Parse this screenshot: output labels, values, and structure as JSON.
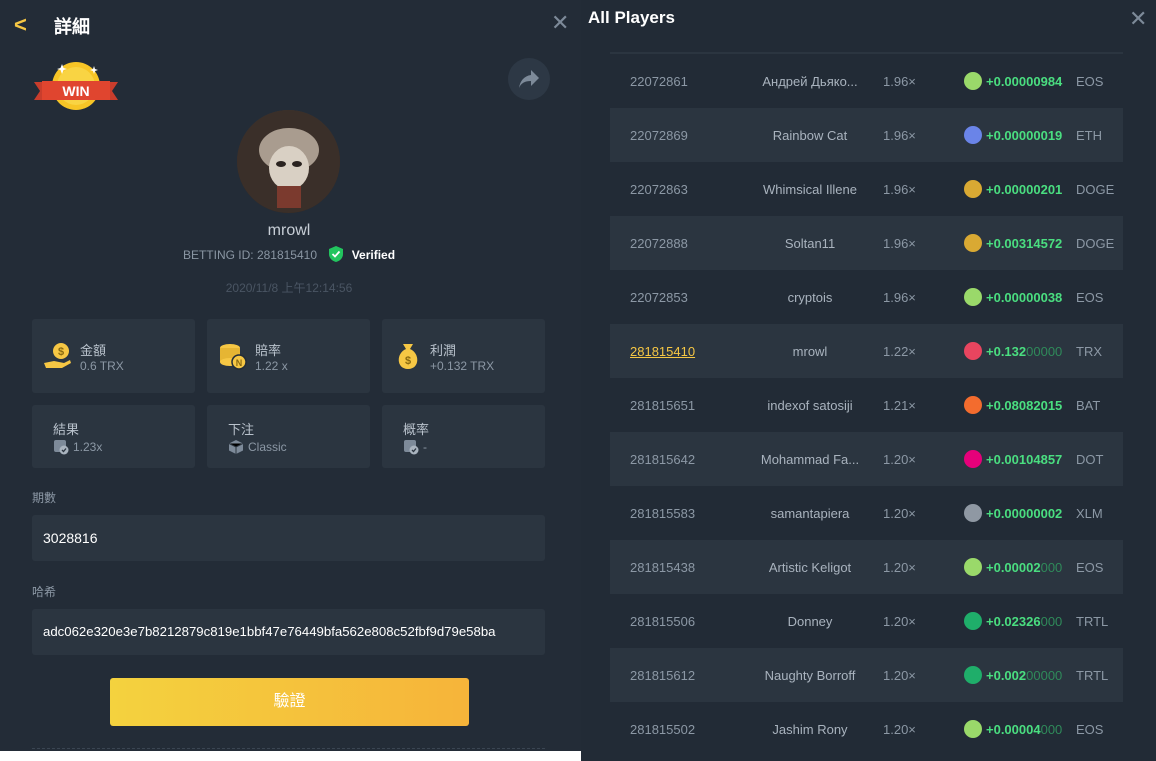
{
  "detail": {
    "back_glyph": "<",
    "title": "詳細",
    "close_glyph": "✕",
    "win_badge": "WIN",
    "username": "mrowl",
    "betting_id": "BETTING ID: 281815410",
    "verified": "Verified",
    "datetime": "2020/11/8 上午12:14:56",
    "stats": [
      {
        "label": "金額",
        "value": "0.6 TRX",
        "icon": "money-hand-icon"
      },
      {
        "label": "賠率",
        "value": "1.22 x",
        "icon": "coin-stack-icon"
      },
      {
        "label": "利潤",
        "value": "+0.132 TRX",
        "icon": "money-bag-icon"
      }
    ],
    "stats2": [
      {
        "label": "結果",
        "value": "1.23x",
        "icon": "dice-check-icon"
      },
      {
        "label": "下注",
        "value": "Classic",
        "icon": "dice-icon"
      },
      {
        "label": "概率",
        "value": "-",
        "icon": "dice-check-icon"
      }
    ],
    "round_label": "期數",
    "round_value": "3028816",
    "hash_label": "哈希",
    "hash_value": "adc062e320e3e7b8212879c819e1bbf47e76449bfa562e808c52fbf9d79e58ba",
    "verify_button": "驗證"
  },
  "players": {
    "title": "All Players",
    "close_glyph": "✕",
    "rows": [
      {
        "id": "22072861",
        "name": "Андрей Дьяко...",
        "multiplier": "1.96×",
        "amount": "+0.00000984",
        "amount_dim": "",
        "currency": "EOS"
      },
      {
        "id": "22072869",
        "name": "Rainbow Cat",
        "multiplier": "1.96×",
        "amount": "+0.00000019",
        "amount_dim": "",
        "currency": "ETH"
      },
      {
        "id": "22072863",
        "name": "Whimsical Illene",
        "multiplier": "1.96×",
        "amount": "+0.00000201",
        "amount_dim": "",
        "currency": "DOGE"
      },
      {
        "id": "22072888",
        "name": "Soltan11",
        "multiplier": "1.96×",
        "amount": "+0.00314572",
        "amount_dim": "",
        "currency": "DOGE"
      },
      {
        "id": "22072853",
        "name": "cryptois",
        "multiplier": "1.96×",
        "amount": "+0.00000038",
        "amount_dim": "",
        "currency": "EOS"
      },
      {
        "id": "281815410",
        "name": "mrowl",
        "multiplier": "1.22×",
        "amount": "+0.132",
        "amount_dim": "00000",
        "currency": "TRX"
      },
      {
        "id": "281815651",
        "name": "indexof satosiji",
        "multiplier": "1.21×",
        "amount": "+0.08082015",
        "amount_dim": "",
        "currency": "BAT"
      },
      {
        "id": "281815642",
        "name": "Mohammad Fa...",
        "multiplier": "1.20×",
        "amount": "+0.00104857",
        "amount_dim": "",
        "currency": "DOT"
      },
      {
        "id": "281815583",
        "name": "samantapiera",
        "multiplier": "1.20×",
        "amount": "+0.00000002",
        "amount_dim": "",
        "currency": "XLM"
      },
      {
        "id": "281815438",
        "name": "Artistic Keligot",
        "multiplier": "1.20×",
        "amount": "+0.00002",
        "amount_dim": "000",
        "currency": "EOS"
      },
      {
        "id": "281815506",
        "name": "Donney",
        "multiplier": "1.20×",
        "amount": "+0.02326",
        "amount_dim": "000",
        "currency": "TRTL"
      },
      {
        "id": "281815612",
        "name": "Naughty Borroff",
        "multiplier": "1.20×",
        "amount": "+0.002",
        "amount_dim": "00000",
        "currency": "TRTL"
      },
      {
        "id": "281815502",
        "name": "Jashim Rony",
        "multiplier": "1.20×",
        "amount": "+0.00004",
        "amount_dim": "000",
        "currency": "EOS"
      }
    ]
  },
  "colors": {
    "accent": "#f6c744",
    "positive": "#4ade80",
    "panel": "#232c37",
    "card": "#2b3540",
    "coin_EOS": "#9ad96a",
    "coin_ETH": "#6a84e8",
    "coin_DOGE": "#d9a933",
    "coin_TRX": "#e8455f",
    "coin_BAT": "#f36c2e",
    "coin_DOT": "#e6007a",
    "coin_XLM": "#8f98a3",
    "coin_TRTL": "#1fae6a"
  }
}
